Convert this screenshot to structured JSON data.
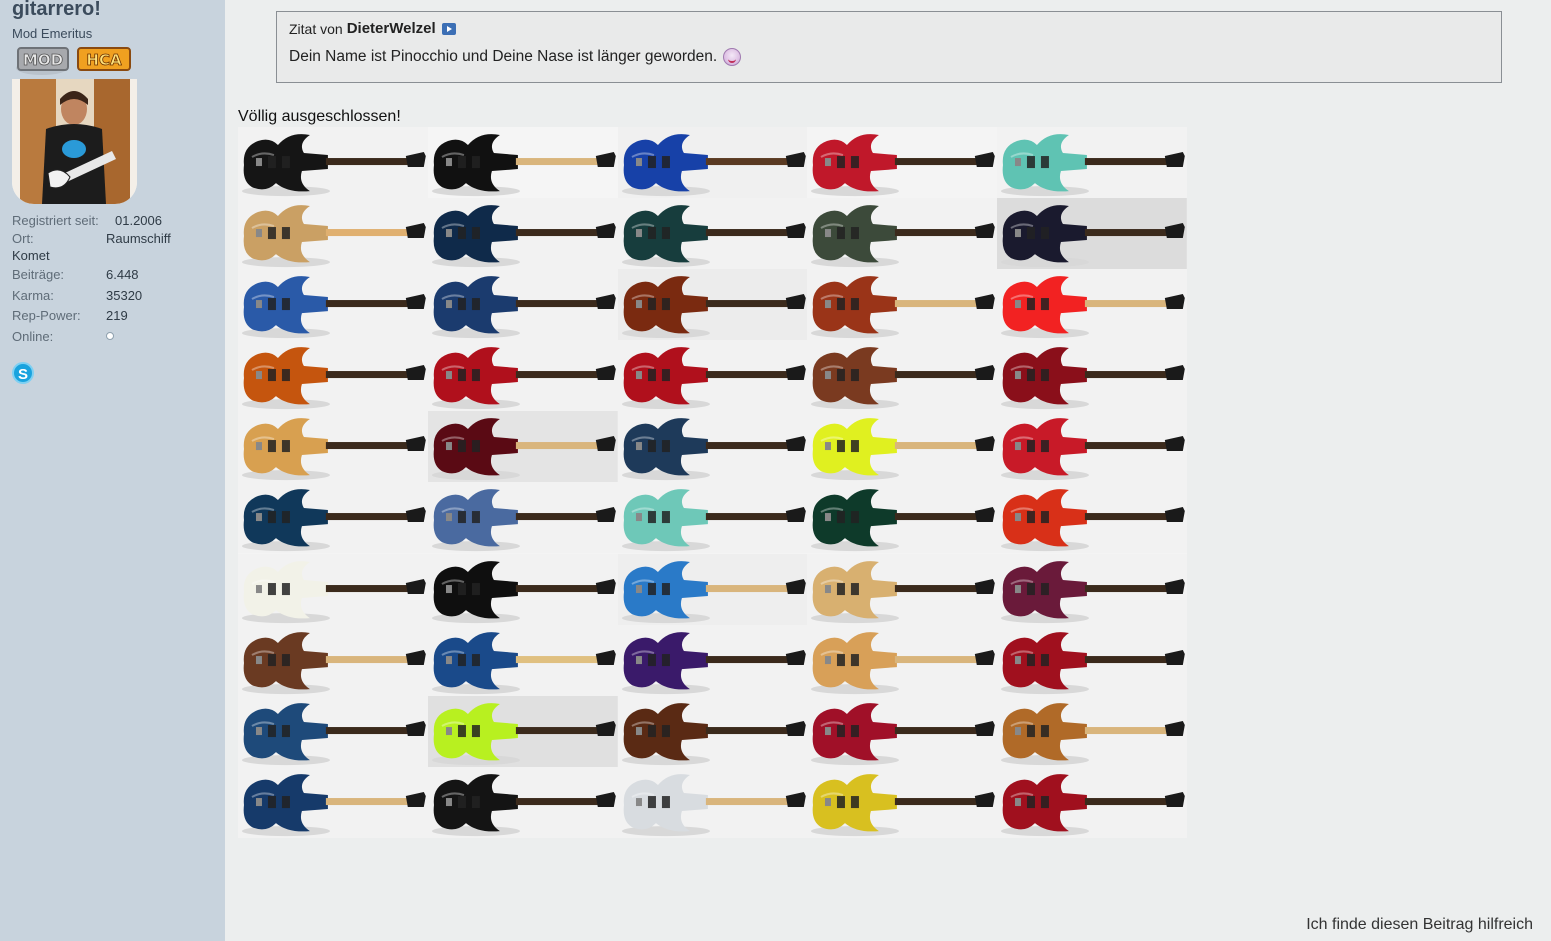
{
  "user": {
    "name": "gitarrero!",
    "title": "Mod Emeritus",
    "badges": [
      "MOD",
      "HCA"
    ],
    "stats": {
      "registered_label": "Registriert seit:",
      "registered_value": "01.2006",
      "location_label": "Ort:",
      "location_value": "Raumschiff",
      "location_value_cont": "Komet",
      "posts_label": "Beiträge:",
      "posts_value": "6.448",
      "karma_label": "Karma:",
      "karma_value": "35320",
      "rep_label": "Rep-Power:",
      "rep_value": "219",
      "online_label": "Online:"
    },
    "skype_glyph": "S"
  },
  "quote": {
    "prefix": "Zitat von",
    "author": "DieterWelzel",
    "text": "Dein Name ist Pinocchio und Deine Nase ist länger geworden."
  },
  "post": {
    "message": "Völlig ausgeschlossen!"
  },
  "guitars": [
    {
      "body": "#151515",
      "bg": "#f2f2f2",
      "neck": "#3b2a1c"
    },
    {
      "body": "#111111",
      "bg": "#f5f5f5",
      "neck": "#d9b57c"
    },
    {
      "body": "#1741a8",
      "bg": "#f0f0f0",
      "neck": "#5a3a22"
    },
    {
      "body": "#c0182a",
      "bg": "#f4f4f4",
      "neck": "#3b2a1c"
    },
    {
      "body": "#5fc3b3",
      "bg": "#f2f2f2",
      "neck": "#3b2a1c"
    },
    {
      "body": "#caa064",
      "bg": "#f2f2f2",
      "neck": "#e0b070"
    },
    {
      "body": "#0f2a4a",
      "bg": "#f2f2f2",
      "neck": "#3b2a1c"
    },
    {
      "body": "#173d3d",
      "bg": "#f2f2f2",
      "neck": "#3b2a1c"
    },
    {
      "body": "#3c4a3a",
      "bg": "#f2f2f2",
      "neck": "#3b2a1c"
    },
    {
      "body": "#1a1a2e",
      "bg": "#dcdcdc",
      "neck": "#3b2a1c"
    },
    {
      "body": "#2a5aa8",
      "bg": "#f2f2f2",
      "neck": "#3b2a1c"
    },
    {
      "body": "#1b3b6e",
      "bg": "#f2f2f2",
      "neck": "#3b2a1c"
    },
    {
      "body": "#7a2a10",
      "bg": "#ececec",
      "neck": "#3b2a1c"
    },
    {
      "body": "#9a3418",
      "bg": "#f2f2f2",
      "neck": "#d9b57c"
    },
    {
      "body": "#f22222",
      "bg": "#f2f2f2",
      "neck": "#d9b57c"
    },
    {
      "body": "#c5550e",
      "bg": "#f2f2f2",
      "neck": "#3b2a1c"
    },
    {
      "body": "#b0101c",
      "bg": "#f2f2f2",
      "neck": "#3b2a1c"
    },
    {
      "body": "#b0101c",
      "bg": "#f2f2f2",
      "neck": "#3b2a1c"
    },
    {
      "body": "#7a3a20",
      "bg": "#f2f2f2",
      "neck": "#3b2a1c"
    },
    {
      "body": "#8a0f1a",
      "bg": "#f2f2f2",
      "neck": "#3b2a1c"
    },
    {
      "body": "#d8a050",
      "bg": "#f2f2f2",
      "neck": "#3b2a1c"
    },
    {
      "body": "#5a0a14",
      "bg": "#e4e4e4",
      "neck": "#d9b57c"
    },
    {
      "body": "#1e3a5a",
      "bg": "#f2f2f2",
      "neck": "#3b2a1c"
    },
    {
      "body": "#e0f020",
      "bg": "#f2f2f2",
      "neck": "#d9b57c"
    },
    {
      "body": "#c81a28",
      "bg": "#f2f2f2",
      "neck": "#3b2a1c"
    },
    {
      "body": "#10385a",
      "bg": "#f2f2f2",
      "neck": "#3b2a1c"
    },
    {
      "body": "#4a6aa0",
      "bg": "#f2f2f2",
      "neck": "#3b2a1c"
    },
    {
      "body": "#6ec8b8",
      "bg": "#f2f2f2",
      "neck": "#3b2a1c"
    },
    {
      "body": "#0e3a2a",
      "bg": "#f2f2f2",
      "neck": "#3b2a1c"
    },
    {
      "body": "#d83018",
      "bg": "#f2f2f2",
      "neck": "#3b2a1c"
    },
    {
      "body": "#f2f2e8",
      "bg": "#f2f2f2",
      "neck": "#3b2a1c"
    },
    {
      "body": "#0f0f0f",
      "bg": "#f2f2f2",
      "neck": "#3b2a1c"
    },
    {
      "body": "#2a7ac8",
      "bg": "#eeeeee",
      "neck": "#d9b57c"
    },
    {
      "body": "#d8b070",
      "bg": "#f2f2f2",
      "neck": "#3b2a1c"
    },
    {
      "body": "#6a1a3a",
      "bg": "#f2f2f2",
      "neck": "#3b2a1c"
    },
    {
      "body": "#6a3a22",
      "bg": "#f2f2f2",
      "neck": "#d9b57c"
    },
    {
      "body": "#1a4a8a",
      "bg": "#f2f2f2",
      "neck": "#e0c080"
    },
    {
      "body": "#3a1a6a",
      "bg": "#f2f2f2",
      "neck": "#3b2a1c"
    },
    {
      "body": "#d8a058",
      "bg": "#f2f2f2",
      "neck": "#d9b57c"
    },
    {
      "body": "#a0101e",
      "bg": "#f2f2f2",
      "neck": "#3b2a1c"
    },
    {
      "body": "#1e4a7a",
      "bg": "#f2f2f2",
      "neck": "#3b2a1c"
    },
    {
      "body": "#b8f020",
      "bg": "#e0e0e0",
      "neck": "#3b2a1c"
    },
    {
      "body": "#5a2a14",
      "bg": "#f2f2f2",
      "neck": "#3b2a1c"
    },
    {
      "body": "#a01028",
      "bg": "#f2f2f2",
      "neck": "#3b2a1c"
    },
    {
      "body": "#b06a28",
      "bg": "#f2f2f2",
      "neck": "#d9b57c"
    },
    {
      "body": "#163a6a",
      "bg": "#f2f2f2",
      "neck": "#d9b57c"
    },
    {
      "body": "#141414",
      "bg": "#f2f2f2",
      "neck": "#3b2a1c"
    },
    {
      "body": "#d8dce0",
      "bg": "#f2f2f2",
      "neck": "#d9b57c"
    },
    {
      "body": "#d8c020",
      "bg": "#f2f2f2",
      "neck": "#3b2a1c"
    },
    {
      "body": "#a0101e",
      "bg": "#f2f2f2",
      "neck": "#3b2a1c"
    }
  ],
  "footer": {
    "helpful_text": "Ich finde diesen Beitrag hilfreich"
  }
}
